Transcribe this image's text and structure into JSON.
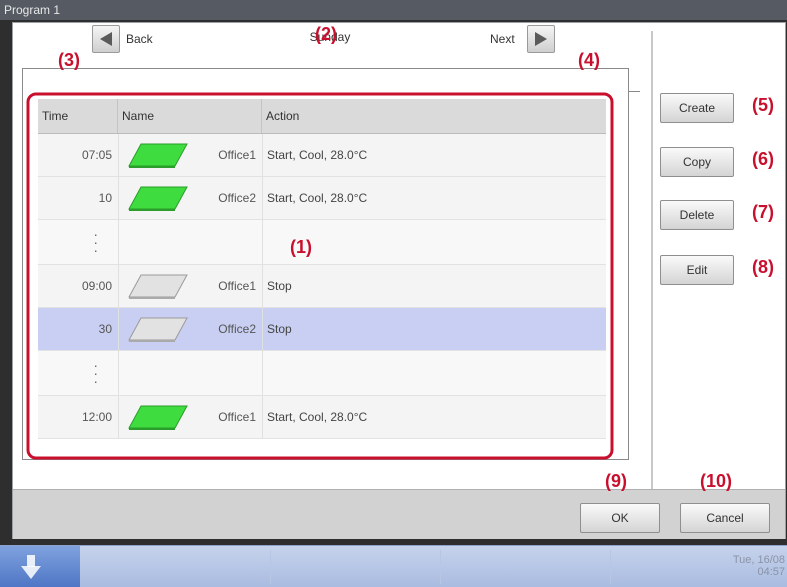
{
  "window": {
    "title": "Program 1"
  },
  "nav": {
    "back_label": "Back",
    "next_label": "Next",
    "day": "Sunday"
  },
  "table": {
    "headers": {
      "time": "Time",
      "name": "Name",
      "action": "Action"
    },
    "rows": [
      {
        "time": "07:05",
        "name": "Office1",
        "action": "Start, Cool, 28.0°C",
        "unit_state": "on",
        "selected": false
      },
      {
        "time": "10",
        "name": "Office2",
        "action": "Start, Cool, 28.0°C",
        "unit_state": "on",
        "selected": false
      },
      {
        "time": "",
        "name": "",
        "action": "",
        "unit_state": "continuation",
        "selected": false
      },
      {
        "time": "09:00",
        "name": "Office1",
        "action": "Stop",
        "unit_state": "off",
        "selected": false
      },
      {
        "time": "30",
        "name": "Office2",
        "action": "Stop",
        "unit_state": "off",
        "selected": true
      },
      {
        "time": "",
        "name": "",
        "action": "",
        "unit_state": "continuation",
        "selected": false
      },
      {
        "time": "12:00",
        "name": "Office1",
        "action": "Start, Cool, 28.0°C",
        "unit_state": "on",
        "selected": false
      }
    ]
  },
  "side_buttons": {
    "create": "Create",
    "copy": "Copy",
    "delete": "Delete",
    "edit": "Edit"
  },
  "bottom_buttons": {
    "ok": "OK",
    "cancel": "Cancel"
  },
  "callouts": {
    "c1": "(1)",
    "c2": "(2)",
    "c3": "(3)",
    "c4": "(4)",
    "c5": "(5)",
    "c6": "(6)",
    "c7": "(7)",
    "c8": "(8)",
    "c9": "(9)",
    "c10": "(10)"
  },
  "taskbar": {
    "date_line1": "Tue, 16/08",
    "date_line2": "04:57"
  },
  "colors": {
    "callout": "#c8102e",
    "unit_on": "#3fdc3f",
    "unit_off": "#d8d8d8",
    "selected_row": "#c9cff2"
  }
}
